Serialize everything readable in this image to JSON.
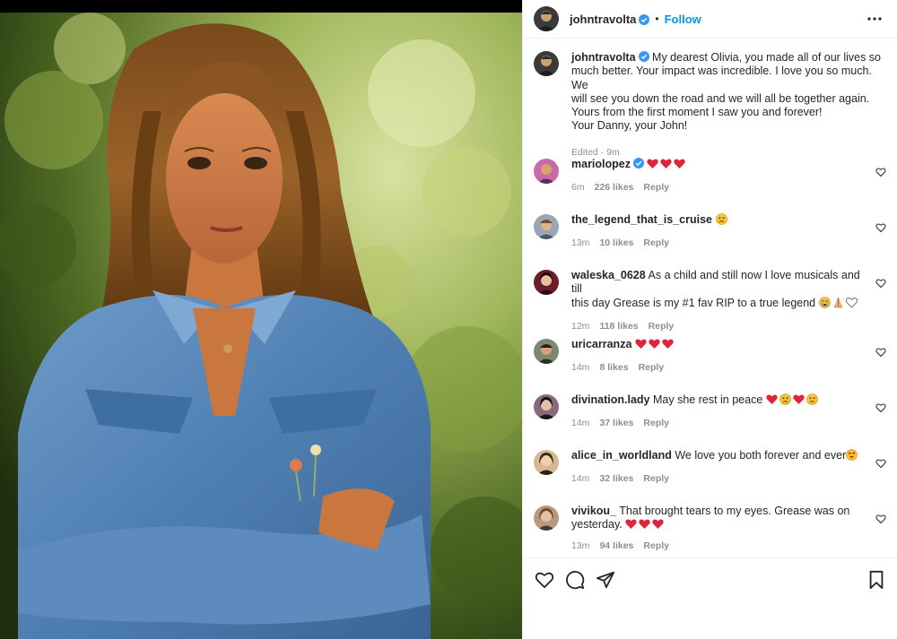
{
  "post": {
    "author": "johntravolta",
    "follow_label": "Follow",
    "dot": "•",
    "caption_lines": [
      "My dearest Olivia, you made all of our lives so",
      "much better. Your impact was incredible. I love you so much. We",
      "will see you down the road and we will all be together again.",
      "Yours from the first moment I saw you and forever!",
      "Your Danny, your John!"
    ],
    "caption_meta": "Edited · 9m"
  },
  "comments": [
    {
      "user": "mariolopez",
      "verified": true,
      "text": "",
      "emojis": [
        "red-heart",
        "red-heart",
        "red-heart"
      ],
      "time": "6m",
      "likes": "226 likes",
      "reply": "Reply"
    },
    {
      "user": "the_legend_that_is_cruise",
      "verified": false,
      "text": "",
      "emojis": [
        "sad-face"
      ],
      "time": "13m",
      "likes": "10 likes",
      "reply": "Reply"
    },
    {
      "user": "waleska_0628",
      "verified": false,
      "text_lines": [
        "As a child and still now I love musicals and till",
        "this day Grease is my #1 fav RIP to a true legend"
      ],
      "emojis": [
        "crying-face",
        "praying-hands",
        "white-heart"
      ],
      "time": "12m",
      "likes": "118 likes",
      "reply": "Reply"
    },
    {
      "user": "uricarranza",
      "verified": false,
      "text": "",
      "emojis": [
        "red-heart",
        "red-heart",
        "red-heart"
      ],
      "time": "14m",
      "likes": "8 likes",
      "reply": "Reply"
    },
    {
      "user": "divination.lady",
      "verified": false,
      "text": "May she rest in peace",
      "emojis": [
        "red-heart",
        "sad-face",
        "red-heart",
        "sad-face"
      ],
      "time": "14m",
      "likes": "37 likes",
      "reply": "Reply"
    },
    {
      "user": "alice_in_worldland",
      "verified": false,
      "text": "We love you both forever and ever",
      "emojis": [
        "heart-eyes-face"
      ],
      "time": "14m",
      "likes": "32 likes",
      "reply": "Reply"
    },
    {
      "user": "vivikou_",
      "verified": false,
      "text_lines": [
        "That brought tears to my eyes. Grease was on",
        "yesterday."
      ],
      "emojis": [
        "red-heart",
        "red-heart",
        "red-heart"
      ],
      "time": "13m",
      "likes": "94 likes",
      "reply": "Reply"
    }
  ],
  "colors": {
    "accent": "#0095f6",
    "heart": "#ed4956",
    "muted": "#8e8e8e",
    "text": "#262626"
  },
  "icons": [
    "more-icon",
    "verified-icon",
    "like-icon",
    "comment-icon",
    "share-icon",
    "save-icon"
  ]
}
